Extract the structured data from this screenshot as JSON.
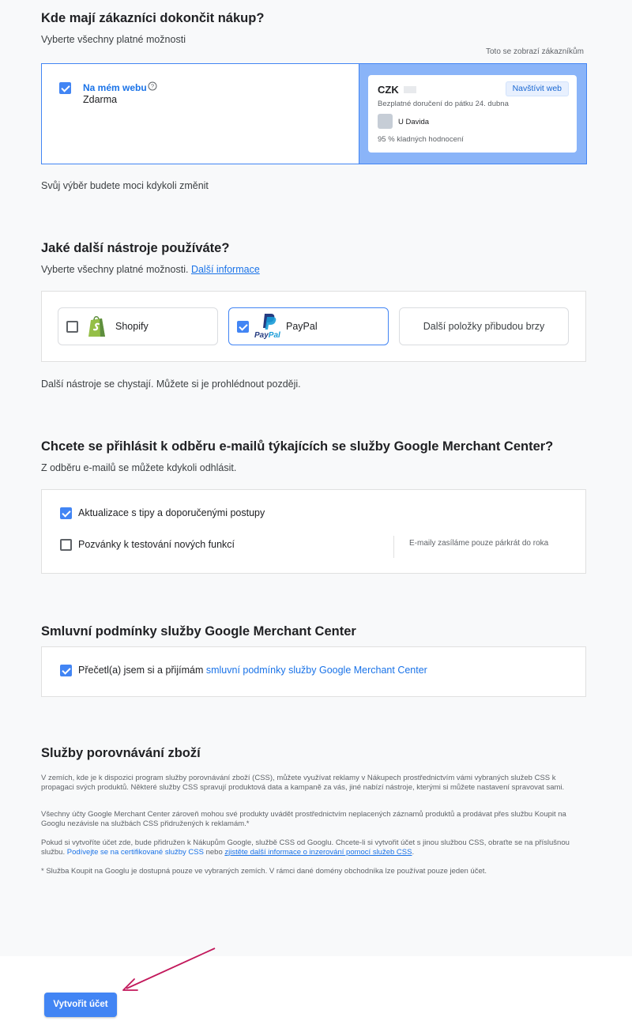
{
  "colors": {
    "accent": "#4285f4",
    "preview_bg": "#8ab4f8",
    "link": "#1a73e8",
    "page_bg": "#f8f9fa"
  },
  "checkout": {
    "title": "Kde mají zákazníci dokončit nákup?",
    "subtitle": "Vyberte všechny platné možnosti",
    "preview_note": "Toto se zobrazí zákazníkům",
    "option_web": {
      "label": "Na mém webu",
      "price": "Zdarma",
      "checked": true,
      "help_icon": "help-circle-icon"
    },
    "preview": {
      "currency": "CZK",
      "visit_button": "Navštívit web",
      "delivery": "Bezplatné doručení do pátku 24. dubna",
      "store_name": "U Davida",
      "rating": "95 % kladných hodnocení"
    },
    "footer": "Svůj výběr budete moci kdykoli změnit"
  },
  "tools": {
    "title": "Jaké další nástroje používáte?",
    "subtitle": "Vyberte všechny platné možnosti.",
    "more_link": "Další informace",
    "items": [
      {
        "label": "Shopify",
        "checked": false,
        "icon": "shopify-icon"
      },
      {
        "label": "PayPal",
        "checked": true,
        "icon": "paypal-icon",
        "logo_text": "PayPal"
      },
      {
        "label": "Další položky přibudou brzy"
      }
    ],
    "footer": "Další nástroje se chystají. Můžete si je prohlédnout později."
  },
  "emails": {
    "title": "Chcete se přihlásit k odběru e-mailů týkajících se služby Google Merchant Center?",
    "subtitle": "Z odběru e-mailů se můžete kdykoli odhlásit.",
    "options": [
      {
        "label": "Aktualizace s tipy a doporučenými postupy",
        "checked": true
      },
      {
        "label": "Pozvánky k testování nových funkcí",
        "checked": false
      }
    ],
    "note": "E-maily zasíláme pouze párkrát do roka"
  },
  "terms": {
    "title": "Smluvní podmínky služby Google Merchant Center",
    "accept_text": "Přečetl(a) jsem si a přijímám",
    "accept_link": "smluvní podmínky služby Google Merchant Center",
    "checked": true
  },
  "css": {
    "title": "Služby porovnávání zboží",
    "p1": "V zemích, kde je k dispozici program služby porovnávání zboží (CSS), můžete využívat reklamy v Nákupech prostřednictvím vámi vybraných služeb CSS k propagaci svých produktů. Některé služby CSS spravují produktová data a kampaně za vás, jiné nabízí nástroje, kterými si můžete nastavení spravovat sami.",
    "p2": "Všechny účty Google Merchant Center zároveň mohou své produkty uvádět prostřednictvím neplacených záznamů produktů a prodávat přes službu Koupit na Googlu nezávisle na službách CSS přidružených k reklamám.*",
    "p3_a": "Pokud si vytvoříte účet zde, bude přidružen k Nákupům Google, službě CSS od Googlu. Chcete-li si vytvořit účet s jinou službou CSS, obraťte se na příslušnou službu.",
    "p3_link1": "Podívejte se na certifikované služby CSS",
    "p3_mid": "nebo",
    "p3_link2": "zjistěte další informace o inzerování pomocí služeb CSS",
    "p3_end": ".",
    "p4": "* Služba Koupit na Googlu je dostupná pouze ve vybraných zemích. V rámci dané domény obchodníka lze používat pouze jeden účet."
  },
  "create_button": "Vytvořit účet"
}
